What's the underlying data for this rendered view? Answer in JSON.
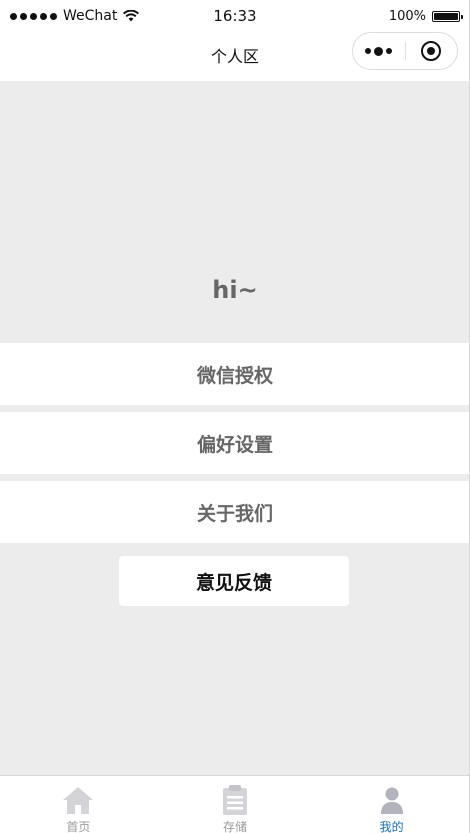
{
  "status_bar": {
    "carrier": "WeChat",
    "time": "16:33",
    "battery_text": "100%",
    "battery_level": 1.0
  },
  "nav": {
    "title": "个人区",
    "capsule_more_icon": "more-dots-icon",
    "capsule_close_icon": "close-circle-icon"
  },
  "profile": {
    "greeting": "hi~"
  },
  "menu": {
    "items": [
      {
        "label": "微信授权"
      },
      {
        "label": "偏好设置"
      },
      {
        "label": "关于我们"
      }
    ],
    "feedback_label": "意见反馈"
  },
  "tab_bar": {
    "tabs": [
      {
        "label": "首页",
        "icon": "home-icon",
        "active": false
      },
      {
        "label": "存储",
        "icon": "clipboard-icon",
        "active": false
      },
      {
        "label": "我的",
        "icon": "user-icon",
        "active": true
      }
    ],
    "colors": {
      "inactive_icon": "#d4d4d8",
      "active_icon": "#b3b3bd",
      "active_label": "#1a6fb8"
    }
  }
}
